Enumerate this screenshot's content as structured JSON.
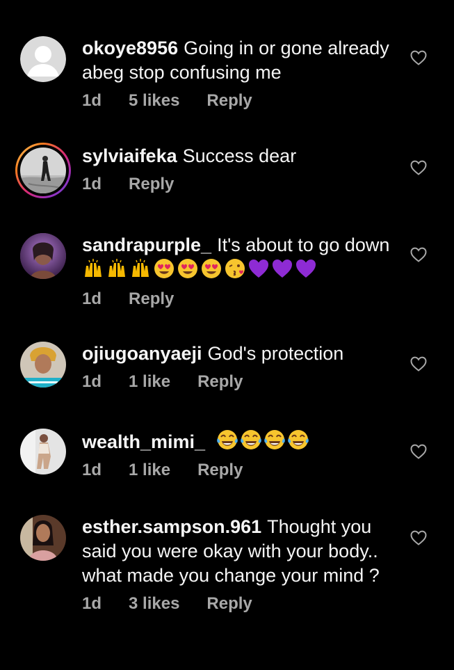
{
  "colors": {
    "background": "#000000",
    "text": "#f5f5f5",
    "meta": "#a8a8a8",
    "heart_outline": "#a8a8a8"
  },
  "icons": {
    "like": "heart-outline-icon"
  },
  "comments": [
    {
      "username": "okoye8956",
      "text": "Going in or gone already abeg stop confusing me",
      "time": "1d",
      "likes": "5 likes",
      "reply": "Reply",
      "avatar": "default-avatar"
    },
    {
      "username": "sylviaifeka",
      "text": "Success dear",
      "time": "1d",
      "reply": "Reply",
      "avatar": "story-ring-avatar"
    },
    {
      "username": "sandrapurple_",
      "text": "It's about to go down",
      "emojis": [
        "raising-hands",
        "raising-hands",
        "raising-hands",
        "heart-eyes",
        "heart-eyes",
        "heart-eyes",
        "kissing-face",
        "purple-heart",
        "purple-heart",
        "purple-heart"
      ],
      "time": "1d",
      "reply": "Reply",
      "avatar": "photo-avatar"
    },
    {
      "username": "ojiugoanyaeji",
      "text": "God's protection",
      "time": "1d",
      "likes": "1 like",
      "reply": "Reply",
      "avatar": "photo-avatar"
    },
    {
      "username": "wealth_mimi_",
      "text": "",
      "emojis": [
        "tears-of-joy",
        "tears-of-joy",
        "tears-of-joy",
        "tears-of-joy"
      ],
      "time": "1d",
      "likes": "1 like",
      "reply": "Reply",
      "avatar": "photo-avatar"
    },
    {
      "username": "esther.sampson.961",
      "text": "Thought you said you were okay with your body.. what made you change your mind ?",
      "time": "1d",
      "likes": "3 likes",
      "reply": "Reply",
      "avatar": "photo-avatar"
    }
  ]
}
